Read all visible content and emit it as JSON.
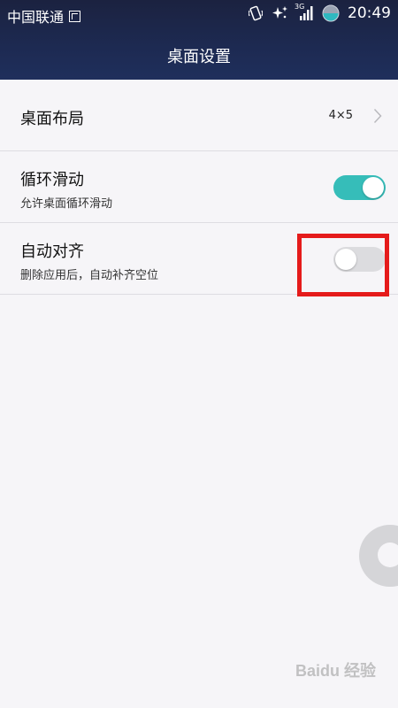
{
  "status_bar": {
    "carrier": "中国联通",
    "network_type": "3G",
    "time": "20:49",
    "icons": [
      "sim-icon",
      "vibrate-icon",
      "sparkle-icon",
      "signal-icon",
      "battery-icon"
    ]
  },
  "header": {
    "title": "桌面设置"
  },
  "settings": [
    {
      "title": "桌面布局",
      "value": "4×5",
      "control": "chevron"
    },
    {
      "title": "循环滑动",
      "subtitle": "允许桌面循环滑动",
      "control": "toggle",
      "state": "on"
    },
    {
      "title": "自动对齐",
      "subtitle": "删除应用后，自动补齐空位",
      "control": "toggle",
      "state": "off"
    }
  ],
  "colors": {
    "toggle_on": "#36bdb9",
    "toggle_off": "#dcdcdf",
    "highlight": "#e51b1b",
    "header_bg": "#1d2a52"
  },
  "watermark": "Baidu 经验"
}
